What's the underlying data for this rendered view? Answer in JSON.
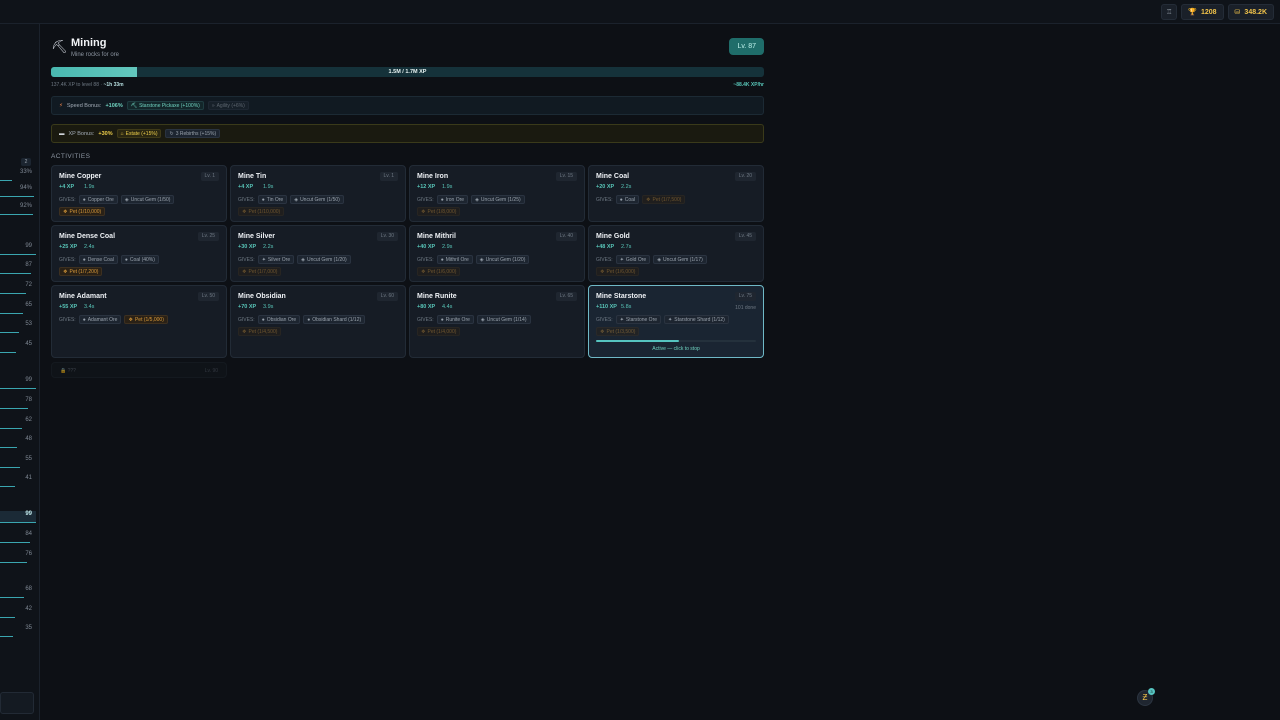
{
  "topbar": {
    "trophy_icon": "trophy-icon",
    "trophies": "1208",
    "gold": "348.2K"
  },
  "sidebar": {
    "badge": "2",
    "rows": [
      {
        "value": "33%",
        "fill": 0.33
      },
      {
        "value": "94%",
        "fill": 0.94
      },
      {
        "value": "92%",
        "fill": 0.92
      },
      {
        "value": "99",
        "fill": 0.99
      },
      {
        "value": "87",
        "fill": 0.87
      },
      {
        "value": "72",
        "fill": 0.72
      },
      {
        "value": "65",
        "fill": 0.65
      },
      {
        "value": "53",
        "fill": 0.53
      },
      {
        "value": "45",
        "fill": 0.45
      },
      {
        "value": "99",
        "fill": 0.99
      },
      {
        "value": "78",
        "fill": 0.78
      },
      {
        "value": "62",
        "fill": 0.62
      },
      {
        "value": "48",
        "fill": 0.48
      },
      {
        "value": "55",
        "fill": 0.55
      },
      {
        "value": "41",
        "fill": 0.41
      },
      {
        "value": "99",
        "fill": 0.99,
        "active": true
      },
      {
        "value": "84",
        "fill": 0.84
      },
      {
        "value": "76",
        "fill": 0.76
      },
      {
        "value": "68",
        "fill": 0.68
      },
      {
        "value": "42",
        "fill": 0.42
      },
      {
        "value": "35",
        "fill": 0.35
      }
    ]
  },
  "skill": {
    "title": "Mining",
    "subtitle": "Mine rocks for ore",
    "level": "Lv. 87",
    "xp_label": "1.5M / 1.7M XP",
    "xp_progress": 0.12,
    "xp_to_level": "137.4K XP to level 88 ·",
    "eta": "~1h 33m",
    "rate": "~88.4K XP/hr"
  },
  "speed_bonus": {
    "label": "Speed Bonus:",
    "value": "+106%",
    "sources": [
      {
        "text": "Starstone Pickaxe (+100%)"
      },
      {
        "text": "Agility (+6%)"
      }
    ]
  },
  "xp_bonus": {
    "label": "XP Bonus:",
    "value": "+30%",
    "sources": [
      {
        "text": "Estate (+15%)"
      },
      {
        "text": "3 Rebirths (+15%)"
      }
    ]
  },
  "section_title": "ACTIVITIES",
  "gives_label": "GIVES:",
  "activities": [
    {
      "name": "Mine Copper",
      "level": "Lv. 1",
      "xp": "+4 XP",
      "time": "1.9s",
      "items": [
        "Copper Ore",
        "Uncut Gem (1/50)"
      ],
      "pet": "Pet (1/10,000)"
    },
    {
      "name": "Mine Tin",
      "level": "Lv. 1",
      "xp": "+4 XP",
      "time": "1.9s",
      "items": [
        "Tin Ore",
        "Uncut Gem (1/50)"
      ],
      "pet": "Pet (1/10,000)"
    },
    {
      "name": "Mine Iron",
      "level": "Lv. 15",
      "xp": "+12 XP",
      "time": "1.9s",
      "items": [
        "Iron Ore",
        "Uncut Gem (1/25)"
      ],
      "pet": "Pet (1/8,000)"
    },
    {
      "name": "Mine Coal",
      "level": "Lv. 20",
      "xp": "+20 XP",
      "time": "2.2s",
      "items": [
        "Coal"
      ],
      "pet": "Pet (1/7,500)"
    },
    {
      "name": "Mine Dense Coal",
      "level": "Lv. 25",
      "xp": "+25 XP",
      "time": "2.4s",
      "items": [
        "Dense Coal",
        "Coal (40%)"
      ],
      "pet": "Pet (1/7,200)"
    },
    {
      "name": "Mine Silver",
      "level": "Lv. 30",
      "xp": "+30 XP",
      "time": "2.2s",
      "items": [
        "Silver Ore",
        "Uncut Gem (1/20)"
      ],
      "pet": "Pet (1/7,000)"
    },
    {
      "name": "Mine Mithril",
      "level": "Lv. 40",
      "xp": "+40 XP",
      "time": "2.9s",
      "items": [
        "Mithril Ore",
        "Uncut Gem (1/20)"
      ],
      "pet": "Pet (1/6,000)"
    },
    {
      "name": "Mine Gold",
      "level": "Lv. 45",
      "xp": "+48 XP",
      "time": "2.7s",
      "items": [
        "Gold Ore",
        "Uncut Gem (1/17)"
      ],
      "pet": "Pet (1/6,000)"
    },
    {
      "name": "Mine Adamant",
      "level": "Lv. 50",
      "xp": "+55 XP",
      "time": "3.4s",
      "items": [
        "Adamant Ore"
      ],
      "pet": "Pet (1/5,000)"
    },
    {
      "name": "Mine Obsidian",
      "level": "Lv. 60",
      "xp": "+70 XP",
      "time": "3.9s",
      "items": [
        "Obsidian Ore",
        "Obsidian Shard (1/12)"
      ],
      "pet": "Pet (1/4,500)"
    },
    {
      "name": "Mine Runite",
      "level": "Lv. 65",
      "xp": "+80 XP",
      "time": "4.4s",
      "items": [
        "Runite Ore",
        "Uncut Gem (1/14)"
      ],
      "pet": "Pet (1/4,000)"
    },
    {
      "name": "Mine Starstone",
      "level": "Lv. 75",
      "xp": "+110 XP",
      "time": "5.8s",
      "done": "101 done",
      "items": [
        "Starstone Ore",
        "Starstone Shard (1/12)"
      ],
      "pet": "Pet (1/3,500)",
      "active": true,
      "progress": 0.52,
      "status": "Active — click to stop"
    }
  ],
  "locked": {
    "name": "???",
    "level": "Lv. 90"
  },
  "fab": {
    "badge": "3"
  }
}
